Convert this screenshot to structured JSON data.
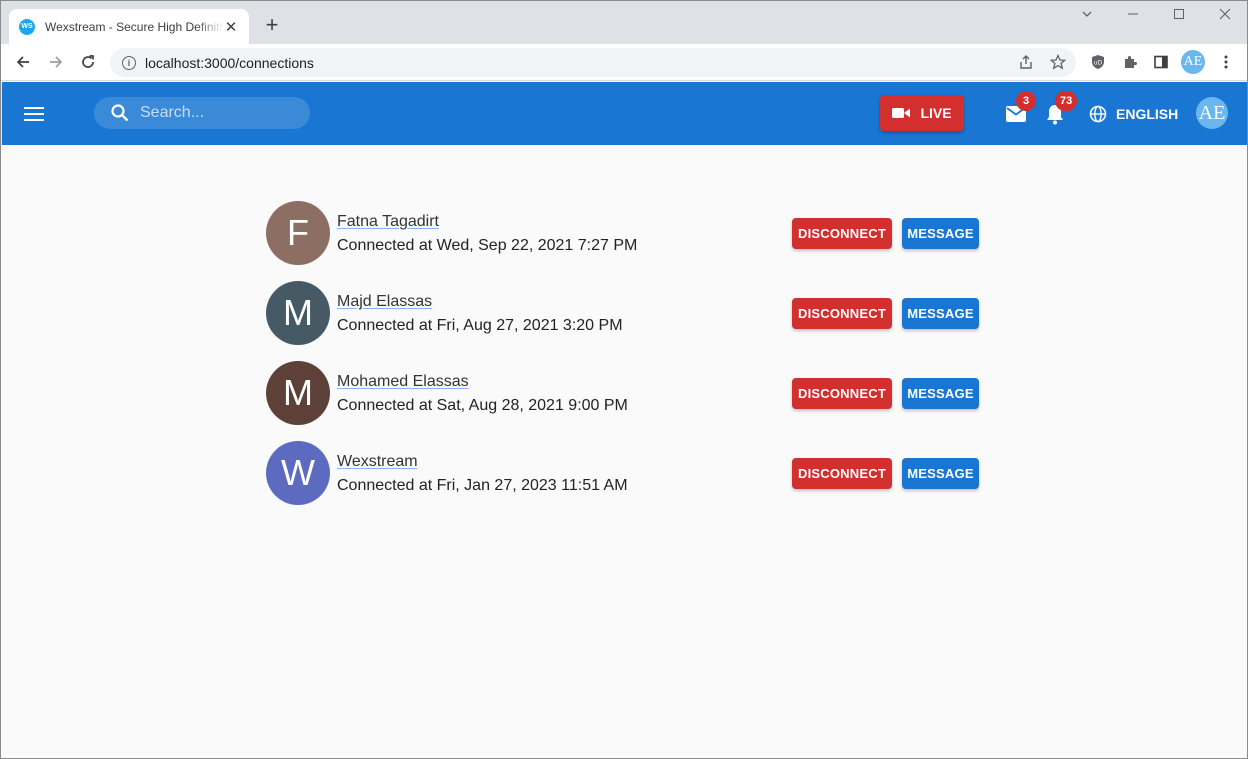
{
  "browser": {
    "tab_title": "Wexstream - Secure High Definition",
    "tab_favicon_text": "WS",
    "url": "localhost:3000/connections",
    "profile_initials": "AE"
  },
  "header": {
    "search_placeholder": "Search...",
    "live_label": "LIVE",
    "messages_badge": "3",
    "notifications_badge": "73",
    "language_label": "ENGLISH",
    "user_initials": "AE",
    "brand_color": "#1976d2",
    "danger_color": "#d32f2f"
  },
  "connections": [
    {
      "initial": "F",
      "name": "Fatna Tagadirt",
      "connected": "Connected at Wed, Sep 22, 2021 7:27 PM",
      "avatar_color": "#8d6e63",
      "disconnect_label": "DISCONNECT",
      "message_label": "MESSAGE"
    },
    {
      "initial": "M",
      "name": "Majd Elassas",
      "connected": "Connected at Fri, Aug 27, 2021 3:20 PM",
      "avatar_color": "#455a64",
      "disconnect_label": "DISCONNECT",
      "message_label": "MESSAGE"
    },
    {
      "initial": "M",
      "name": "Mohamed Elassas",
      "connected": "Connected at Sat, Aug 28, 2021 9:00 PM",
      "avatar_color": "#5d4037",
      "disconnect_label": "DISCONNECT",
      "message_label": "MESSAGE"
    },
    {
      "initial": "W",
      "name": "Wexstream",
      "connected": "Connected at Fri, Jan 27, 2023 11:51 AM",
      "avatar_color": "#5c6bc0",
      "disconnect_label": "DISCONNECT",
      "message_label": "MESSAGE"
    }
  ]
}
